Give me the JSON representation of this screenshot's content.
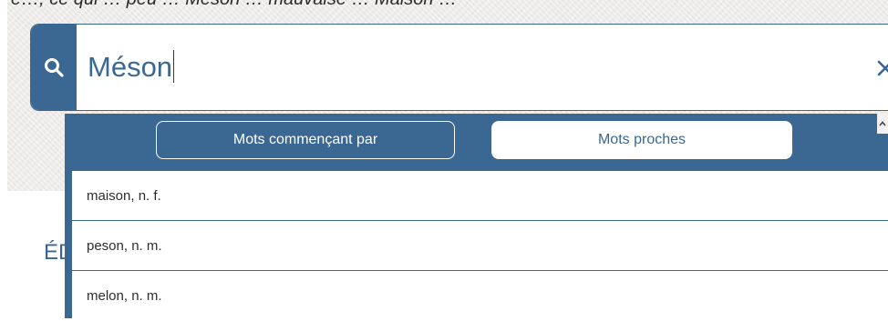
{
  "page": {
    "top_text": "e…, ce qui …  peu … Meson … mauvaise … Maison …",
    "heading_fragment": "ÉD"
  },
  "search": {
    "value": "Méson",
    "search_icon": "search-icon",
    "clear_icon": "close-icon",
    "accent_color": "#3a6892"
  },
  "dropdown": {
    "tabs": [
      {
        "label": "Mots commençant par",
        "active": false
      },
      {
        "label": "Mots proches",
        "active": true
      }
    ],
    "results": [
      {
        "label": "maison, n. f."
      },
      {
        "label": "peson, n. m."
      },
      {
        "label": "melon, n. m."
      }
    ],
    "scroll_icon": "chevron-up-icon"
  }
}
